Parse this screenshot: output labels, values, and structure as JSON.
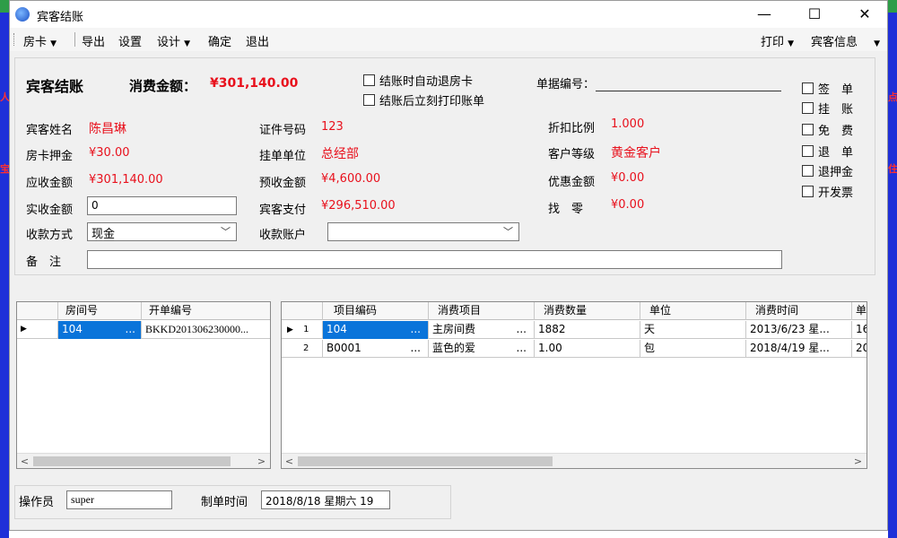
{
  "window": {
    "title": "宾客结账",
    "min": "—",
    "max": "☐",
    "close": "✕"
  },
  "menu": {
    "fangka": "房卡",
    "export": "导出",
    "settings": "设置",
    "design": "设计",
    "confirm": "确定",
    "exit": "退出",
    "print": "打印",
    "guest_info": "宾客信息"
  },
  "header": {
    "title": "宾客结账",
    "total_label": "消费金额：",
    "total_value": "¥301,140.00",
    "auto_checkout": "结账时自动退房卡",
    "print_after": "结账后立刻打印账单",
    "bill_no_label": "单据编号："
  },
  "side_options": [
    "签　单",
    "挂　账",
    "免　费",
    "退　单",
    "退押金",
    "开发票"
  ],
  "fields": {
    "guest_name_label": "宾客姓名",
    "guest_name": "陈昌琳",
    "id_no_label": "证件号码",
    "id_no": "123",
    "discount_label": "折扣比例",
    "discount": "1.000",
    "deposit_label": "房卡押金",
    "deposit": "¥30.00",
    "unit_label": "挂单单位",
    "unit": "总经部",
    "level_label": "客户等级",
    "level": "黄金客户",
    "receivable_label": "应收金额",
    "receivable": "¥301,140.00",
    "prepaid_label": "预收金额",
    "prepaid": "¥4,600.00",
    "favor_label": "优惠金额",
    "favor": "¥0.00",
    "actual_label": "实收金额",
    "actual": "0",
    "guest_pay_label": "宾客支付",
    "guest_pay": "¥296,510.00",
    "change_label": "找　零",
    "change": "¥0.00",
    "pay_method_label": "收款方式",
    "pay_method": "现金",
    "account_label": "收款账户",
    "account": "",
    "remark_label": "备　注",
    "remark": ""
  },
  "rooms_table": {
    "headers": [
      "房间号",
      "开单编号"
    ],
    "rows": [
      {
        "marker": "▶",
        "room": "104",
        "dots": "...",
        "order": "BKKD201306230000..."
      }
    ]
  },
  "items_table": {
    "headers": [
      "项目编码",
      "消费项目",
      "消费数量",
      "单位",
      "消费时间",
      "单"
    ],
    "rows": [
      {
        "marker": "▶",
        "num": "1",
        "code": "104",
        "code_dots": "...",
        "item": "主房间费",
        "item_dots": "...",
        "qty": "1882",
        "unit": "天",
        "time": "2013/6/23 星...",
        "extra": "16"
      },
      {
        "marker": "",
        "num": "2",
        "code": "B0001",
        "code_dots": "...",
        "item": "蓝色的爱",
        "item_dots": "...",
        "qty": "1.00",
        "unit": "包",
        "time": "2018/4/19 星...",
        "extra": "20"
      }
    ]
  },
  "footer": {
    "operator_label": "操作员",
    "operator": "super",
    "time_label": "制单时间",
    "time": "2018/8/18 星期六 19"
  },
  "colors": {
    "accent_red": "#e8101c",
    "selection_blue": "#0a74da"
  }
}
